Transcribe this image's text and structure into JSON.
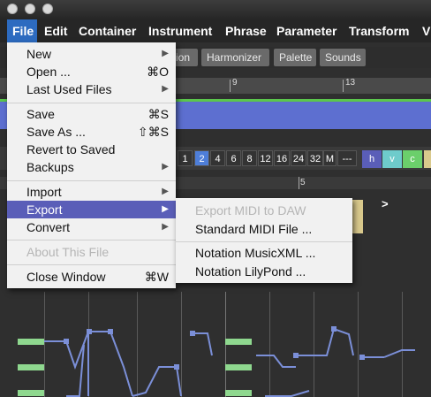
{
  "menubar": {
    "items": [
      "File",
      "Edit",
      "Container",
      "Instrument",
      "Phrase",
      "Parameter",
      "Transform",
      "V"
    ]
  },
  "tabs": [
    "ion",
    "Harmonizer",
    "Palette",
    "Sounds"
  ],
  "timeline": {
    "ticks": [
      "9",
      "13"
    ]
  },
  "grid_buttons": [
    "1",
    "2",
    "4",
    "6",
    "8",
    "12",
    "16",
    "24",
    "32",
    "M",
    "---"
  ],
  "hvc_buttons": [
    "h",
    "v",
    "c"
  ],
  "ruler2": {
    "mark": "5"
  },
  "chevron": ">",
  "file_menu": {
    "items": [
      {
        "label": "New",
        "shortcut": "",
        "submenu": true,
        "disabled": false
      },
      {
        "label": "Open ...",
        "shortcut": "⌘O",
        "submenu": false,
        "disabled": false
      },
      {
        "label": "Last Used Files",
        "shortcut": "",
        "submenu": true,
        "disabled": false
      },
      {
        "label": "Save",
        "shortcut": "⌘S",
        "submenu": false,
        "disabled": false
      },
      {
        "label": "Save As ...",
        "shortcut": "⇧⌘S",
        "submenu": false,
        "disabled": false
      },
      {
        "label": "Revert to Saved",
        "shortcut": "",
        "submenu": false,
        "disabled": false
      },
      {
        "label": "Backups",
        "shortcut": "",
        "submenu": true,
        "disabled": false
      },
      {
        "label": "Import",
        "shortcut": "",
        "submenu": true,
        "disabled": false
      },
      {
        "label": "Export",
        "shortcut": "",
        "submenu": true,
        "disabled": false,
        "highlighted": true
      },
      {
        "label": "Convert",
        "shortcut": "",
        "submenu": true,
        "disabled": false
      },
      {
        "label": "About This File",
        "shortcut": "",
        "submenu": false,
        "disabled": true
      },
      {
        "label": "Close Window",
        "shortcut": "⌘W",
        "submenu": false,
        "disabled": false
      }
    ]
  },
  "export_submenu": {
    "items": [
      {
        "label": "Export MIDI to DAW",
        "disabled": true
      },
      {
        "label": "Standard MIDI File ...",
        "disabled": false
      },
      {
        "label": "Notation MusicXML ...",
        "disabled": false
      },
      {
        "label": "Notation LilyPond ...",
        "disabled": false
      }
    ]
  },
  "colors": {
    "menu_highlight": "#5a5eb8",
    "menubar_active": "#2d6bc0",
    "track": "#5d6fd0",
    "note": "#7b8fd8",
    "bar": "#8fd88f"
  }
}
